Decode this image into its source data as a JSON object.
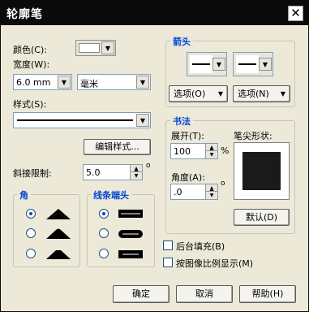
{
  "window": {
    "title": "轮廓笔"
  },
  "color": {
    "label": "颜色(C):"
  },
  "width": {
    "label": "宽度(W):",
    "value": "6.0 mm",
    "unit": "毫米"
  },
  "style": {
    "label": "样式(S):",
    "edit_button": "编辑样式..."
  },
  "miter": {
    "label": "斜接限制:",
    "value": "5.0",
    "degree_symbol": "o"
  },
  "corners": {
    "title": "角",
    "selected_index": 0
  },
  "line_caps": {
    "title": "线条端头",
    "selected_index": 0
  },
  "arrows": {
    "title": "箭头",
    "options_left": "选项(O)",
    "options_right": "选项(N)"
  },
  "calligraphy": {
    "title": "书法",
    "stretch_label": "展开(T):",
    "stretch_value": "100",
    "stretch_unit": "%",
    "angle_label": "角度(A):",
    "angle_value": ".0",
    "angle_unit": "o",
    "nib_label": "笔尖形状:",
    "default_button": "默认(D)"
  },
  "checks": {
    "behind_fill": "后台填充(B)",
    "scale_with_image": "按图像比例显示(M)"
  },
  "footer": {
    "ok": "确定",
    "cancel": "取消",
    "help": "帮助(H)"
  }
}
